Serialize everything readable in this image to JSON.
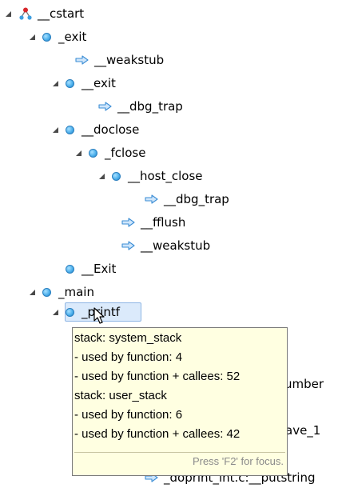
{
  "tree": {
    "nodes": [
      {
        "label": "__cstart",
        "icon": "call-root-icon"
      },
      {
        "label": "_exit",
        "icon": "function-dot-icon"
      },
      {
        "label": "__weakstub",
        "icon": "arrow-right-icon"
      },
      {
        "label": "__exit",
        "icon": "function-dot-icon"
      },
      {
        "label": "__dbg_trap",
        "icon": "arrow-right-icon"
      },
      {
        "label": "__doclose",
        "icon": "function-dot-icon"
      },
      {
        "label": "_fclose",
        "icon": "function-dot-icon"
      },
      {
        "label": "__host_close",
        "icon": "function-dot-icon"
      },
      {
        "label": "__dbg_trap",
        "icon": "arrow-right-icon"
      },
      {
        "label": "__fflush",
        "icon": "arrow-right-icon"
      },
      {
        "label": "__weakstub",
        "icon": "arrow-right-icon"
      },
      {
        "label": "__Exit",
        "icon": "function-dot-icon"
      },
      {
        "label": "_main",
        "icon": "function-dot-icon"
      },
      {
        "label": "_printf",
        "icon": "function-dot-icon"
      },
      {
        "label": "_doprint_int.c:__putstring",
        "icon": "arrow-right-icon"
      }
    ],
    "partially_hidden": {
      "umber": "umber",
      "ave_1": "ave_1"
    }
  },
  "tooltip": {
    "lines": [
      "stack: system_stack",
      "- used by function: 4",
      "- used by function + callees: 52",
      "stack: user_stack",
      "- used by function: 6",
      "- used by function + callees: 42"
    ],
    "hint": "Press 'F2' for focus."
  }
}
